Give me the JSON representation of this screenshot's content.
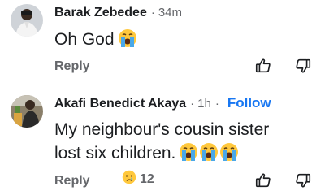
{
  "comments": [
    {
      "author": "Barak Zebedee",
      "separator": "·",
      "time": "34m",
      "text": "Oh God",
      "reply_label": "Reply"
    },
    {
      "author": "Akafi Benedict Akaya",
      "separator": "·",
      "time": "1h",
      "follow_label": "Follow",
      "text_line1": "My neighbour's cousin sister",
      "text_line2": "lost six children.",
      "reply_label": "Reply",
      "reaction_count": "12"
    }
  ],
  "colors": {
    "link": "#1877f2",
    "muted": "#65676b",
    "text": "#1c1e21",
    "emoji_face": "#ffc83d",
    "tears": "#4aa8e8"
  }
}
